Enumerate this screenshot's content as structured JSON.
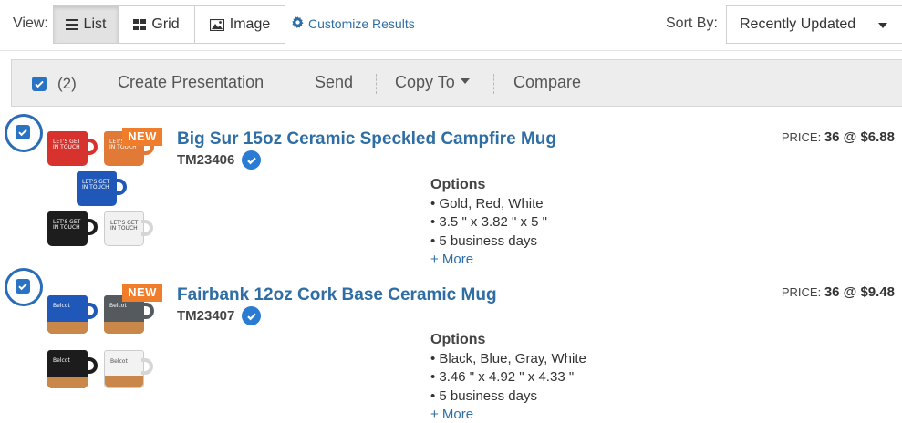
{
  "toolbar": {
    "view_label": "View:",
    "views": [
      {
        "label": "List",
        "icon": "list-icon",
        "active": true
      },
      {
        "label": "Grid",
        "icon": "grid-icon",
        "active": false
      },
      {
        "label": "Image",
        "icon": "image-icon",
        "active": false
      }
    ],
    "customize_label": "Customize Results",
    "sort_label": "Sort By:",
    "sort_value": "Recently Updated"
  },
  "actions": {
    "select_all_checked": true,
    "selected_count": "(2)",
    "items": [
      "Create Presentation",
      "Send",
      "Copy To",
      "Compare"
    ]
  },
  "products": [
    {
      "checked": true,
      "badge": "NEW",
      "title": "Big Sur 15oz Ceramic Speckled Campfire Mug",
      "code": "TM23406",
      "price_label": "PRICE:",
      "price_value": "36 @ $6.88",
      "options_title": "Options",
      "options": [
        "• Gold, Red, White",
        "• 3.5 \" x 3.82 \" x 5 \"",
        "• 5 business days"
      ],
      "more_label": "+ More",
      "mug_text": "LET'S GET IN TOUCH"
    },
    {
      "checked": true,
      "badge": "NEW",
      "title": "Fairbank 12oz Cork Base Ceramic Mug",
      "code": "TM23407",
      "price_label": "PRICE:",
      "price_value": "36 @ $9.48",
      "options_title": "Options",
      "options": [
        "• Black, Blue, Gray, White",
        "• 3.46 \" x 4.92 \" x 4.33 \"",
        "• 5 business days"
      ],
      "more_label": "+ More",
      "mug_text": "Belcot"
    }
  ],
  "colors": {
    "accent": "#2f6ea5",
    "checkbox": "#2a72c4",
    "badge": "#f07d2b",
    "cork": "#c9874a"
  }
}
